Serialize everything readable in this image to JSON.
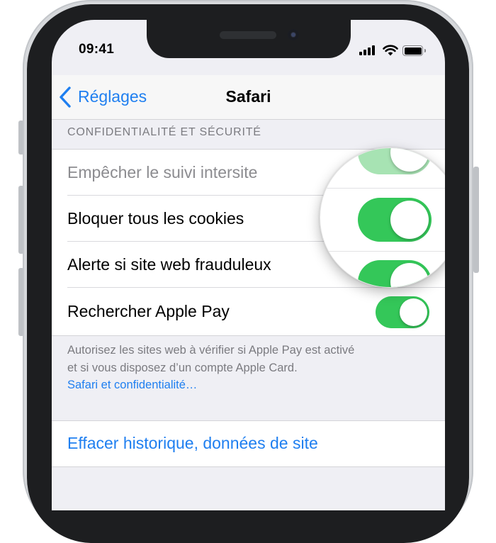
{
  "status_bar": {
    "time": "09:41"
  },
  "nav": {
    "back_label": "Réglages",
    "title": "Safari"
  },
  "section": {
    "header": "CONFIDENTIALITÉ ET SÉCURITÉ",
    "rows": [
      {
        "label": "Empêcher le suivi intersite",
        "toggle_on": true
      },
      {
        "label": "Bloquer tous les cookies",
        "toggle_on": true
      },
      {
        "label": "Alerte si site web frauduleux",
        "toggle_on": true
      },
      {
        "label": "Rechercher Apple Pay",
        "toggle_on": true
      }
    ],
    "footer_line1": "Autorisez les sites web à vérifier si Apple Pay est activé",
    "footer_line2": "et si vous disposez d’un compte Apple Card.",
    "footer_link": "Safari et confidentialité…"
  },
  "actions": {
    "clear_history": "Effacer historique, données de site"
  },
  "colors": {
    "accent": "#1f7ff0",
    "toggle_on": "#34c759",
    "background": "#efeff4"
  }
}
